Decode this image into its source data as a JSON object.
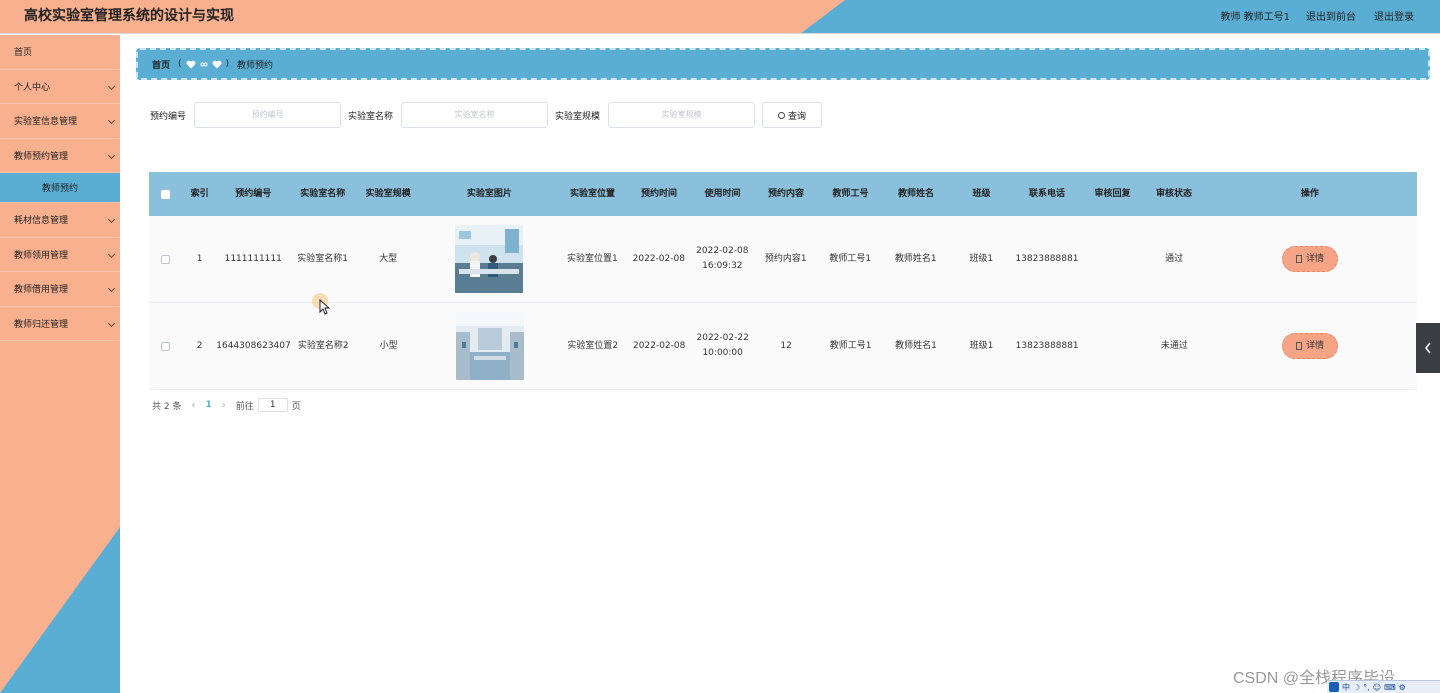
{
  "header": {
    "title": "高校实验室管理系统的设计与实现",
    "user_info": "教师 教师工号1",
    "front_link": "退出到前台",
    "logout_link": "退出登录"
  },
  "sidebar": {
    "items": [
      {
        "label": "首页",
        "chevron": false
      },
      {
        "label": "个人中心",
        "chevron": true
      },
      {
        "label": "实验室信息管理",
        "chevron": true
      },
      {
        "label": "教师预约管理",
        "chevron": true
      },
      {
        "label": "教师预约",
        "sub": true
      },
      {
        "label": "耗材信息管理",
        "chevron": true
      },
      {
        "label": "教师领用管理",
        "chevron": true
      },
      {
        "label": "教师借用管理",
        "chevron": true
      },
      {
        "label": "教师归还管理",
        "chevron": true
      }
    ]
  },
  "breadcrumb": {
    "home": "首页",
    "current": "教师预约"
  },
  "search": {
    "fields": [
      {
        "label": "预约编号",
        "placeholder": "预约编号"
      },
      {
        "label": "实验室名称",
        "placeholder": "实验室名称"
      },
      {
        "label": "实验室规模",
        "placeholder": "实验室规模"
      }
    ],
    "button_label": "查询"
  },
  "table": {
    "headers": [
      "索引",
      "预约编号",
      "实验室名称",
      "实验室规模",
      "实验室图片",
      "实验室位置",
      "预约时间",
      "使用时间",
      "预约内容",
      "教师工号",
      "教师姓名",
      "班级",
      "联系电话",
      "审核回复",
      "审核状态",
      "操作"
    ],
    "rows": [
      {
        "index": "1",
        "booking_no": "1111111111",
        "lab_name": "实验室名称1",
        "scale": "大型",
        "position": "实验室位置1",
        "booking_time": "2022-02-08",
        "use_time": "2022-02-08 16:09:32",
        "content": "预约内容1",
        "teacher_no": "教师工号1",
        "teacher_name": "教师姓名1",
        "class": "班级1",
        "phone": "13823888881",
        "reply": "",
        "status": "通过",
        "action": "详情"
      },
      {
        "index": "2",
        "booking_no": "1644308623407",
        "lab_name": "实验室名称2",
        "scale": "小型",
        "position": "实验室位置2",
        "booking_time": "2022-02-08",
        "use_time": "2022-02-22 10:00:00",
        "content": "12",
        "teacher_no": "教师工号1",
        "teacher_name": "教师姓名1",
        "class": "班级1",
        "phone": "13823888881",
        "reply": "",
        "status": "未通过",
        "action": "详情"
      }
    ]
  },
  "pagination": {
    "total": "共 2 条",
    "current_page": "1",
    "goto_label": "前往",
    "goto_value": "1",
    "page_suffix": "页"
  },
  "watermark": "CSDN @全栈程序毕设",
  "tray": "中",
  "colors": {
    "accent_blue": "#5aaed4",
    "accent_peach": "#f9b08f",
    "table_header": "#8ac0dc"
  }
}
